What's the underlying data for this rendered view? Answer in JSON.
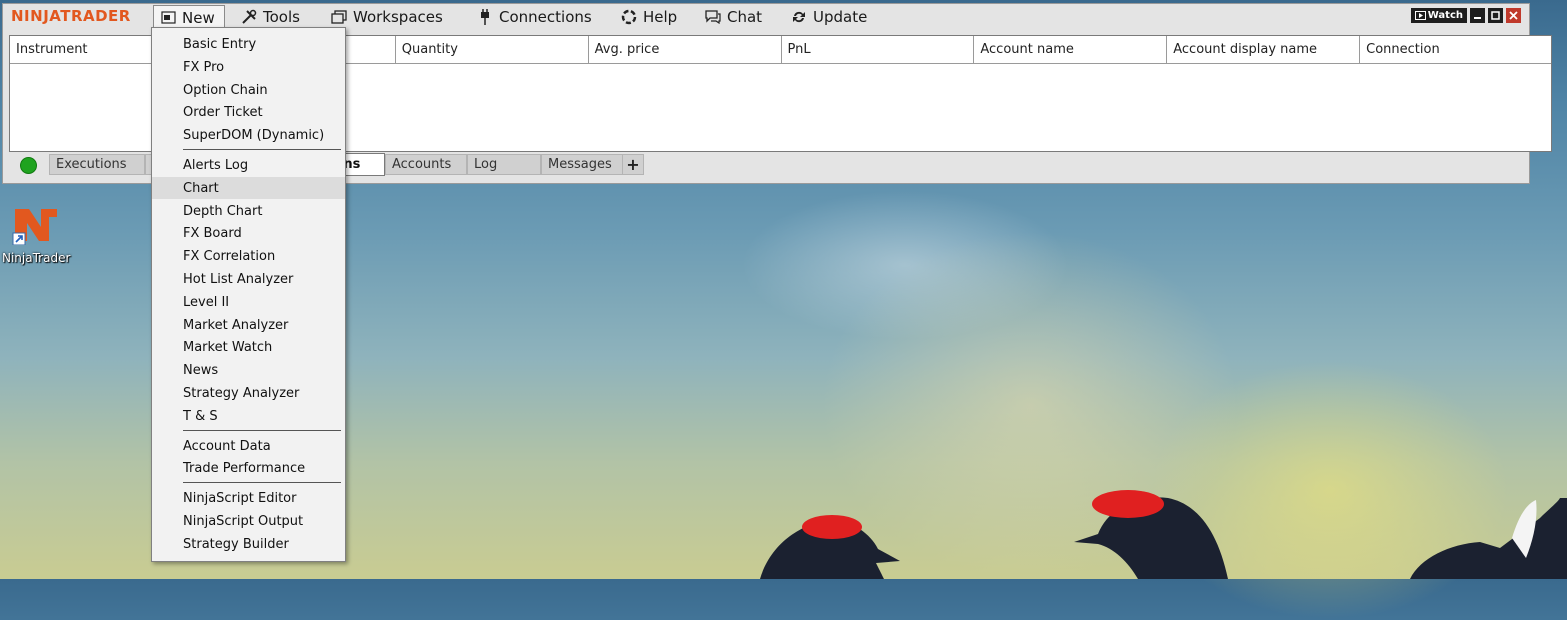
{
  "app": {
    "logo": "NINJATRADER",
    "menu": {
      "new": "New",
      "tools": "Tools",
      "workspaces": "Workspaces",
      "connections": "Connections",
      "help": "Help",
      "chat": "Chat",
      "update": "Update"
    },
    "window_controls": {
      "watch": "Watch"
    }
  },
  "grid": {
    "columns": [
      "Instrument",
      "",
      "Quantity",
      "Avg. price",
      "PnL",
      "Account name",
      "Account display name",
      "Connection"
    ]
  },
  "tabs": {
    "items": [
      "Executions",
      "O",
      "ions",
      "Accounts",
      "Log",
      "Messages"
    ],
    "active": "ions",
    "add": "+"
  },
  "new_menu": {
    "group1": [
      "Basic Entry",
      "FX Pro",
      "Option Chain",
      "Order Ticket",
      "SuperDOM (Dynamic)"
    ],
    "group2": [
      "Alerts Log",
      "Chart",
      "Depth Chart",
      "FX Board",
      "FX Correlation",
      "Hot List Analyzer",
      "Level II",
      "Market Analyzer",
      "Market Watch",
      "News",
      "Strategy Analyzer",
      "T & S"
    ],
    "group3": [
      "Account Data",
      "Trade Performance"
    ],
    "group4": [
      "NinjaScript Editor",
      "NinjaScript Output",
      "Strategy Builder"
    ],
    "hovered": "Chart"
  },
  "desktop": {
    "icon_label": "NinjaTrader",
    "brand_color": "#e2581f"
  }
}
